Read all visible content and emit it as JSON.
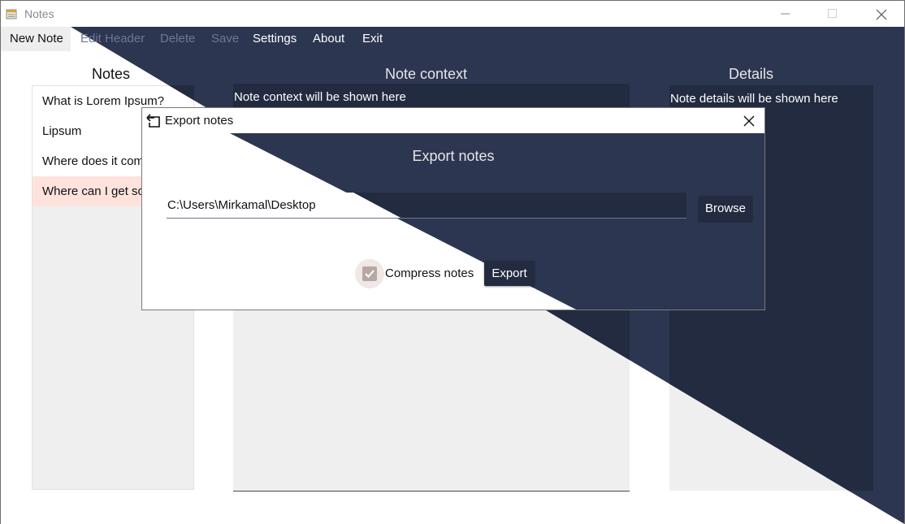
{
  "window": {
    "title": "Notes",
    "controls": {
      "minimize": "minimize-icon",
      "maximize": "maximize-icon",
      "close": "close-icon"
    }
  },
  "menu": {
    "items": [
      {
        "label": "New Note",
        "enabled": true
      },
      {
        "label": "Edit Header",
        "enabled": false
      },
      {
        "label": "Delete",
        "enabled": false
      },
      {
        "label": "Save",
        "enabled": false
      },
      {
        "label": "Settings",
        "enabled": true
      },
      {
        "label": "About",
        "enabled": true
      },
      {
        "label": "Exit",
        "enabled": true
      }
    ]
  },
  "columns": {
    "notes_header": "Notes",
    "context_header": "Note context",
    "details_header": "Details"
  },
  "notes_list": [
    {
      "title": "What is Lorem Ipsum?",
      "selected": false
    },
    {
      "title": "Lipsum",
      "selected": false
    },
    {
      "title": "Where does it come from?",
      "selected": false
    },
    {
      "title": "Where can I get some?",
      "selected": true
    }
  ],
  "context_placeholder": "Note context will be shown here",
  "details_placeholder": "Note details will be shown here",
  "dialog": {
    "title": "Export notes",
    "heading": "Export notes",
    "path_value": "C:\\Users\\Mirkamal\\Desktop",
    "browse_label": "Browse",
    "compress_label": "Compress notes",
    "compress_checked": true,
    "export_label": "Export"
  },
  "theme": {
    "dark_bg": "#2c3651",
    "dark_panel": "#232b40",
    "light_bg": "#ffffff",
    "light_panel": "#efefef",
    "selected_row": "#fde3dc",
    "checkbox_accent": "#b6a8a4"
  }
}
